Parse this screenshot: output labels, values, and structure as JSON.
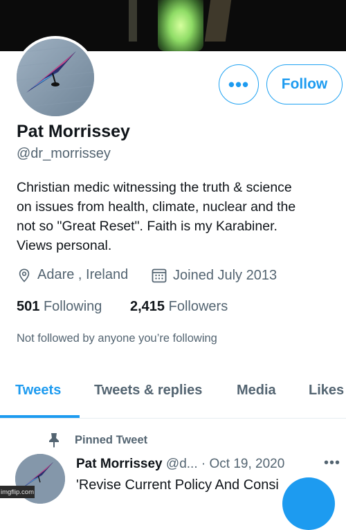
{
  "profile": {
    "name": "Pat Morrissey",
    "handle": "@dr_morrissey",
    "bio": "Christian medic witnessing the truth & science\non issues from health, climate, nuclear and the\nnot so \"Great Reset\". Faith is my Karabiner.\nViews personal.",
    "location": "Adare , Ireland",
    "joined": "Joined July 2013",
    "following_count": "501",
    "following_label": "Following",
    "followers_count": "2,415",
    "followers_label": "Followers",
    "not_followed_text": "Not followed by anyone you’re following"
  },
  "actions": {
    "more_label": "•••",
    "follow_label": "Follow"
  },
  "tabs": [
    {
      "label": "Tweets",
      "active": true
    },
    {
      "label": "Tweets & replies",
      "active": false
    },
    {
      "label": "Media",
      "active": false
    },
    {
      "label": "Likes",
      "active": false
    }
  ],
  "pinned_tweet": {
    "pinned_label": "Pinned Tweet",
    "author_name": "Pat Morrissey",
    "author_handle": "@d...",
    "separator": "·",
    "date": "Oct 19, 2020",
    "more_label": "•••",
    "text": "'Revise Current Policy And Consi"
  },
  "watermark": "imgflip.com",
  "colors": {
    "accent": "#1d9bf0",
    "text_primary": "#0f1419",
    "text_secondary": "#536471"
  },
  "icons": [
    "location-pin-icon",
    "calendar-icon",
    "pin-icon",
    "more-icon"
  ]
}
